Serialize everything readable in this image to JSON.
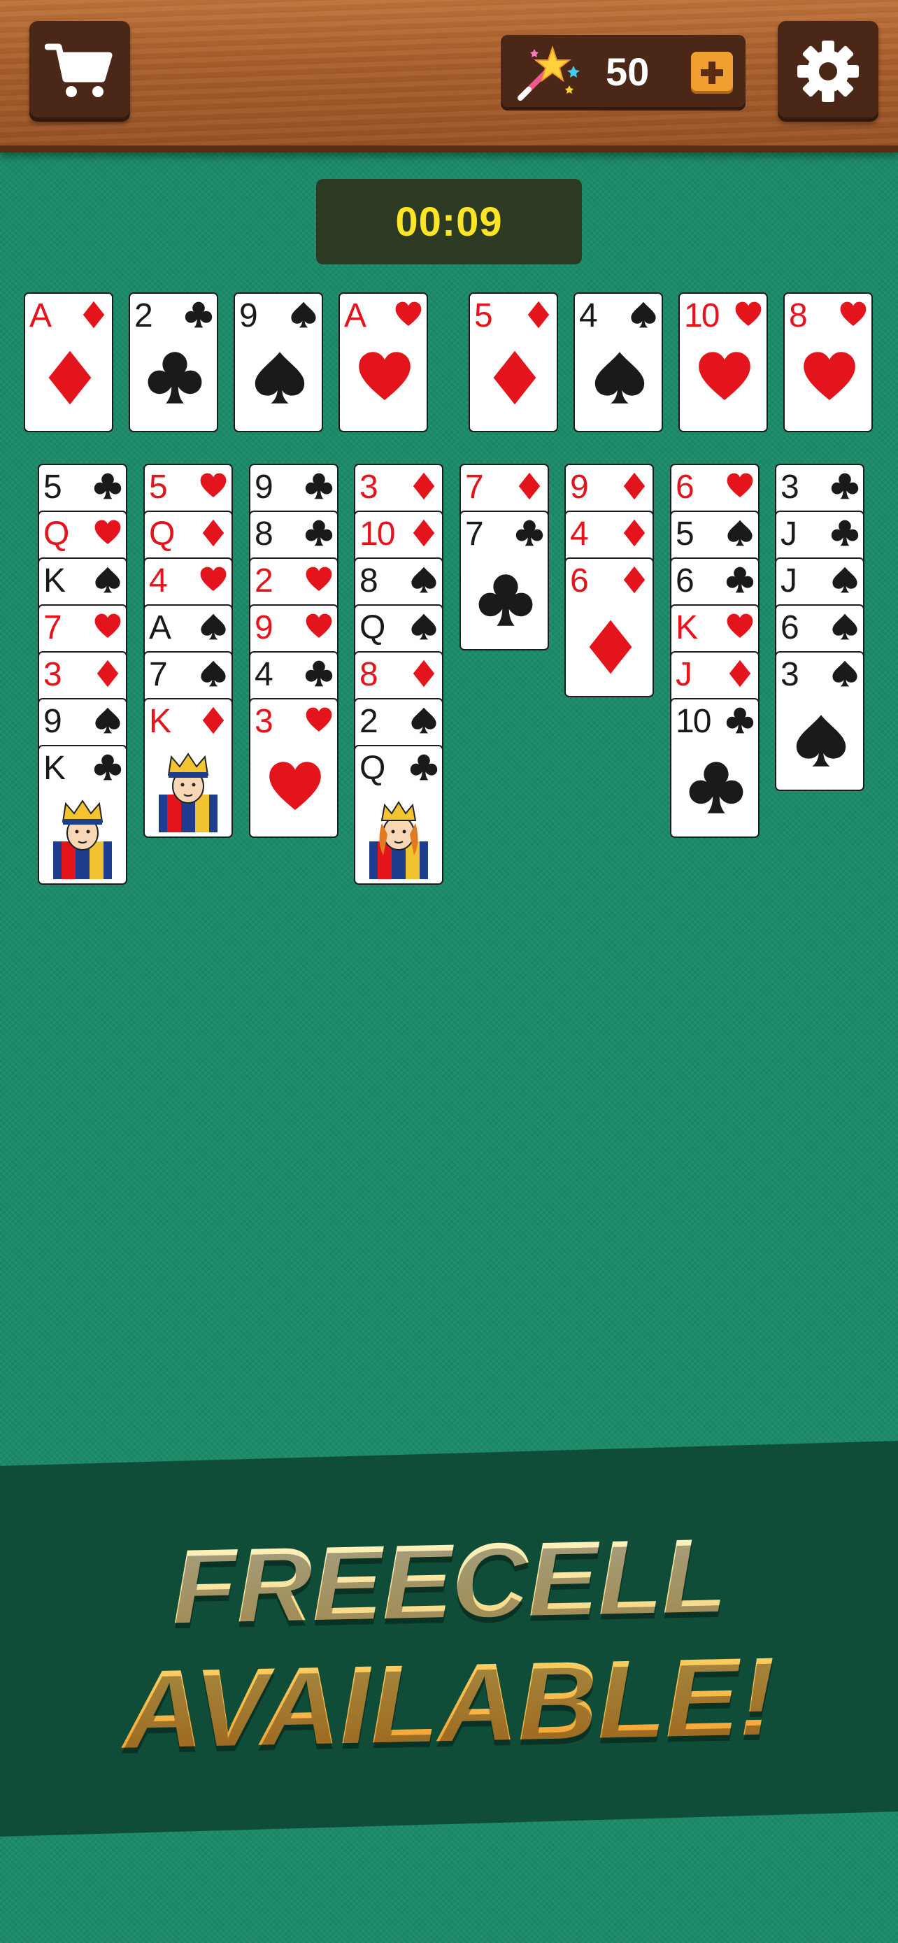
{
  "header": {
    "shop_icon": "cart-icon",
    "settings_icon": "gear-icon",
    "coins": "50",
    "coin_icon": "magic-wand-icon",
    "add_icon": "plus-icon"
  },
  "timer": "00:09",
  "colors": {
    "red": "#e4141c",
    "black": "#1a1a1a",
    "felt": "#1b8a68",
    "timer_text": "#ffe523"
  },
  "foundations": [
    {
      "rank": "A",
      "suit": "diamonds"
    },
    {
      "rank": "2",
      "suit": "clubs"
    },
    {
      "rank": "9",
      "suit": "spades"
    },
    {
      "rank": "A",
      "suit": "hearts"
    }
  ],
  "free_cells": [
    {
      "rank": "5",
      "suit": "diamonds"
    },
    {
      "rank": "4",
      "suit": "spades"
    },
    {
      "rank": "10",
      "suit": "hearts"
    },
    {
      "rank": "8",
      "suit": "hearts"
    }
  ],
  "tableau": [
    [
      {
        "rank": "5",
        "suit": "clubs"
      },
      {
        "rank": "Q",
        "suit": "hearts"
      },
      {
        "rank": "K",
        "suit": "spades"
      },
      {
        "rank": "7",
        "suit": "hearts"
      },
      {
        "rank": "3",
        "suit": "diamonds"
      },
      {
        "rank": "9",
        "suit": "spades"
      },
      {
        "rank": "K",
        "suit": "clubs"
      }
    ],
    [
      {
        "rank": "5",
        "suit": "hearts"
      },
      {
        "rank": "Q",
        "suit": "diamonds"
      },
      {
        "rank": "4",
        "suit": "hearts"
      },
      {
        "rank": "A",
        "suit": "spades"
      },
      {
        "rank": "7",
        "suit": "spades"
      },
      {
        "rank": "K",
        "suit": "diamonds"
      }
    ],
    [
      {
        "rank": "9",
        "suit": "clubs"
      },
      {
        "rank": "8",
        "suit": "clubs"
      },
      {
        "rank": "2",
        "suit": "hearts"
      },
      {
        "rank": "9",
        "suit": "hearts"
      },
      {
        "rank": "4",
        "suit": "clubs"
      },
      {
        "rank": "3",
        "suit": "hearts"
      }
    ],
    [
      {
        "rank": "3",
        "suit": "diamonds"
      },
      {
        "rank": "10",
        "suit": "diamonds"
      },
      {
        "rank": "8",
        "suit": "spades"
      },
      {
        "rank": "Q",
        "suit": "spades"
      },
      {
        "rank": "8",
        "suit": "diamonds"
      },
      {
        "rank": "2",
        "suit": "spades"
      },
      {
        "rank": "Q",
        "suit": "clubs"
      }
    ],
    [
      {
        "rank": "7",
        "suit": "diamonds"
      },
      {
        "rank": "7",
        "suit": "clubs"
      }
    ],
    [
      {
        "rank": "9",
        "suit": "diamonds"
      },
      {
        "rank": "4",
        "suit": "diamonds"
      },
      {
        "rank": "6",
        "suit": "diamonds"
      }
    ],
    [
      {
        "rank": "6",
        "suit": "hearts"
      },
      {
        "rank": "5",
        "suit": "spades"
      },
      {
        "rank": "6",
        "suit": "clubs"
      },
      {
        "rank": "K",
        "suit": "hearts"
      },
      {
        "rank": "J",
        "suit": "diamonds"
      },
      {
        "rank": "10",
        "suit": "clubs"
      }
    ],
    [
      {
        "rank": "3",
        "suit": "clubs"
      },
      {
        "rank": "J",
        "suit": "clubs"
      },
      {
        "rank": "J",
        "suit": "spades"
      },
      {
        "rank": "6",
        "suit": "spades"
      },
      {
        "rank": "3",
        "suit": "spades"
      }
    ]
  ],
  "banner": {
    "line1": "FREECELL",
    "line2": "AVAILABLE!"
  }
}
